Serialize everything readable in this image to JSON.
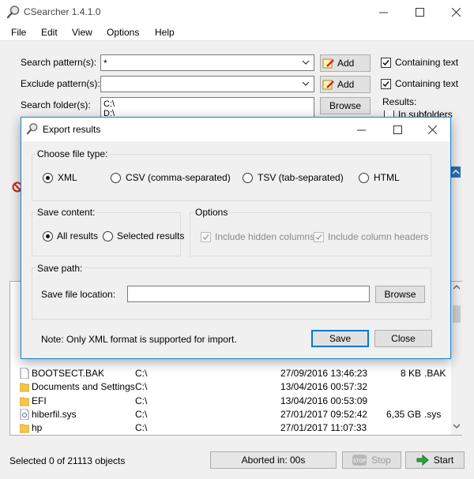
{
  "window": {
    "title": "CSearcher 1.4.1.0"
  },
  "menu": [
    "File",
    "Edit",
    "View",
    "Options",
    "Help"
  ],
  "search": {
    "pattern_label": "Search pattern(s):",
    "pattern_value": "*",
    "exclude_label": "Exclude pattern(s):",
    "exclude_value": "",
    "folder_label": "Search folder(s):",
    "folders": [
      "C:\\",
      "D:\\"
    ],
    "add_label": "Add",
    "browse_label": "Browse",
    "containing_text": "Containing text",
    "results_label": "Results:",
    "subfolders_label": "In subfolders"
  },
  "file_list": [
    {
      "name": "BOOTSECT.BAK",
      "path": "C:\\",
      "date": "27/09/2016 13:46:23",
      "size": "8 KB",
      "ext": ".BAK",
      "icon": "file-icon"
    },
    {
      "name": "Documents and Settings",
      "path": "C:\\",
      "date": "13/04/2016 00:57:32",
      "size": "",
      "ext": "",
      "icon": "folder-icon"
    },
    {
      "name": "EFI",
      "path": "C:\\",
      "date": "13/04/2016 00:53:09",
      "size": "",
      "ext": "",
      "icon": "folder-icon"
    },
    {
      "name": "hiberfil.sys",
      "path": "C:\\",
      "date": "27/01/2017 09:52:42",
      "size": "6,35 GB",
      "ext": ".sys",
      "icon": "system-file-icon"
    },
    {
      "name": "hp",
      "path": "C:\\",
      "date": "27/01/2017 11:07:33",
      "size": "",
      "ext": "",
      "icon": "folder-icon"
    }
  ],
  "status": {
    "selected_text": "Selected 0 of 21113 objects",
    "aborted_text": "Aborted in: 00s",
    "stop_label": "Stop",
    "start_label": "Start"
  },
  "dialog": {
    "title": "Export results",
    "file_type_label": "Choose file type:",
    "file_types": [
      "XML",
      "CSV (comma-separated)",
      "TSV (tab-separated)",
      "HTML"
    ],
    "selected_file_type": "XML",
    "save_content_label": "Save content:",
    "save_content_options": [
      "All results",
      "Selected results"
    ],
    "selected_save_content": "All results",
    "options_label": "Options",
    "option_hidden_columns": "Include hidden columns",
    "option_column_headers": "Include column headers",
    "save_path_label": "Save path:",
    "save_file_location_label": "Save file location:",
    "save_file_location_value": "",
    "browse_label": "Browse",
    "note": "Note: Only XML format is supported for import.",
    "save_label": "Save",
    "close_label": "Close"
  }
}
